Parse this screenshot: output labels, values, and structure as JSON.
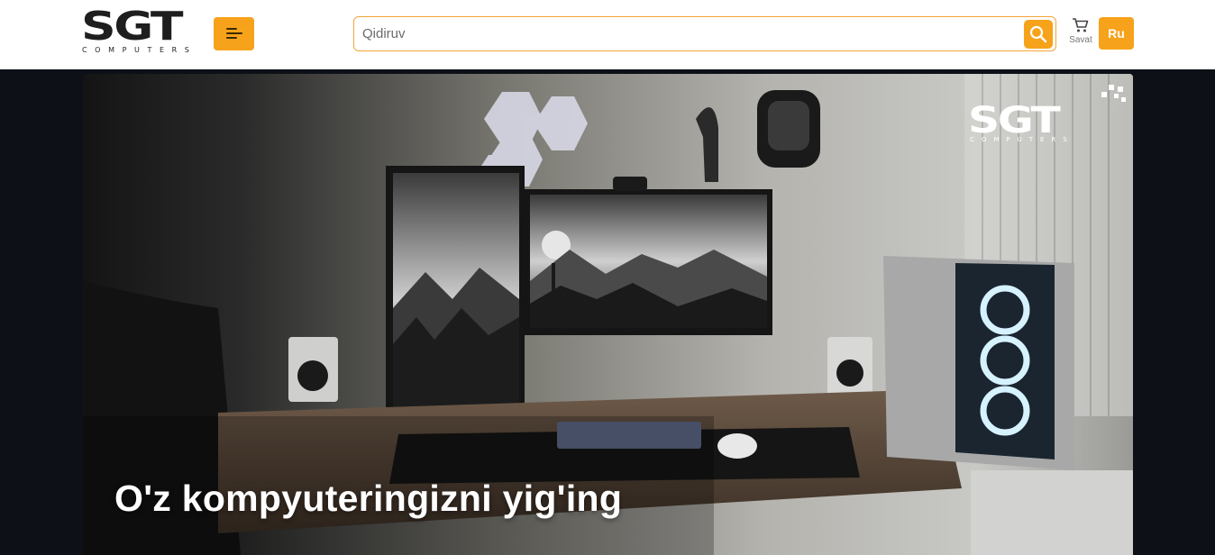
{
  "header": {
    "logo_text": "SGT",
    "logo_subtext": "COMPUTERS",
    "menu_icon": "hamburger-menu-icon",
    "search": {
      "placeholder": "Qidiruv",
      "value": "",
      "icon": "search-icon"
    },
    "cart": {
      "label": "Savat",
      "icon": "cart-icon"
    },
    "language_button": "Ru"
  },
  "hero": {
    "title": "O'z kompyuteringizni yig'ing",
    "watermark_logo_text": "SGT",
    "watermark_logo_subtext": "COMPUTERS"
  },
  "colors": {
    "accent": "#f7a21b",
    "header_bg": "#ffffff",
    "page_bg": "#0d1117",
    "logo_dark": "#1e1e1e"
  }
}
